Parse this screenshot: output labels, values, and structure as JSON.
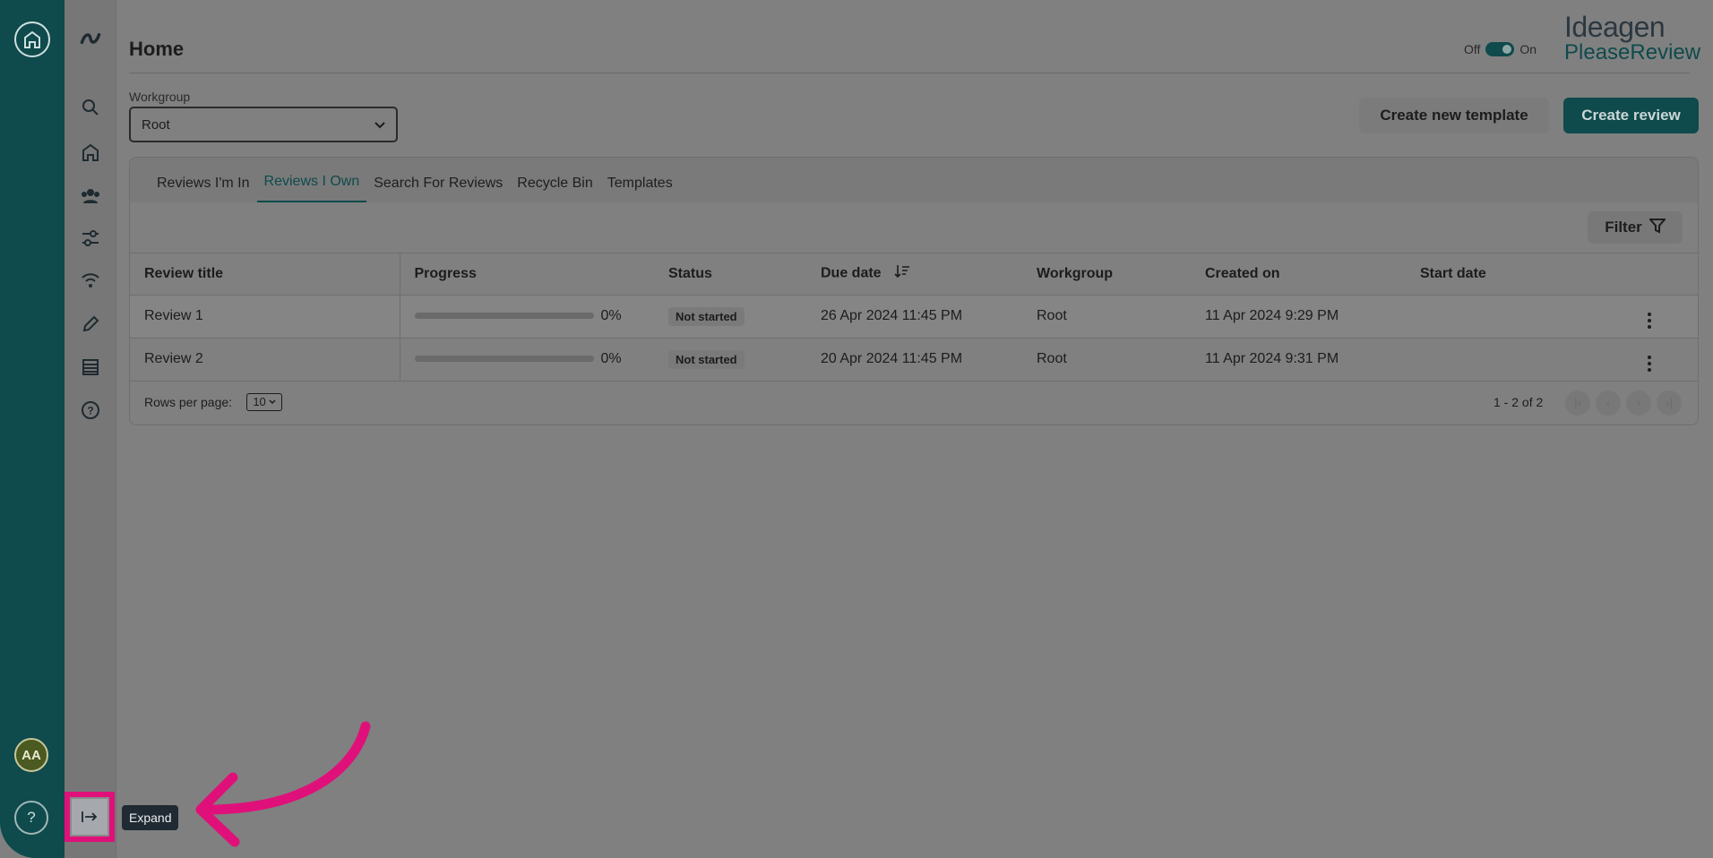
{
  "rail": {
    "avatar": "AA",
    "help": "?"
  },
  "nav": {
    "items": [
      {
        "name": "search-icon"
      },
      {
        "name": "home-icon"
      },
      {
        "name": "people-icon"
      },
      {
        "name": "sliders-icon"
      },
      {
        "name": "broadcast-icon"
      },
      {
        "name": "pencil-icon"
      },
      {
        "name": "list-icon"
      },
      {
        "name": "help-circle-icon"
      }
    ],
    "expand_tooltip": "Expand"
  },
  "header": {
    "title": "Home",
    "toggle_off": "Off",
    "toggle_on": "On",
    "logo_line1": "Ideagen",
    "logo_line2": "PleaseReview"
  },
  "workgroup": {
    "label": "Workgroup",
    "value": "Root"
  },
  "actions": {
    "create_template": "Create new template",
    "create_review": "Create review"
  },
  "tabs": [
    {
      "label": "Reviews I'm In",
      "active": false
    },
    {
      "label": "Reviews I Own",
      "active": true
    },
    {
      "label": "Search For Reviews",
      "active": false
    },
    {
      "label": "Recycle Bin",
      "active": false
    },
    {
      "label": "Templates",
      "active": false
    }
  ],
  "filter_label": "Filter",
  "table": {
    "columns": [
      "Review title",
      "Progress",
      "Status",
      "Due date",
      "Workgroup",
      "Created on",
      "Start date"
    ],
    "rows": [
      {
        "title": "Review 1",
        "progress": 0,
        "progress_label": "0%",
        "status": "Not started",
        "due": "26 Apr 2024 11:45 PM",
        "workgroup": "Root",
        "created": "11 Apr 2024 9:29 PM",
        "start": ""
      },
      {
        "title": "Review 2",
        "progress": 0,
        "progress_label": "0%",
        "status": "Not started",
        "due": "20 Apr 2024 11:45 PM",
        "workgroup": "Root",
        "created": "11 Apr 2024 9:31 PM",
        "start": ""
      }
    ]
  },
  "footer": {
    "rows_per_page_label": "Rows per page:",
    "rows_per_page": "10",
    "range": "1 - 2 of 2"
  },
  "colors": {
    "accent": "#0f4a4c",
    "highlight": "#e0107a"
  }
}
